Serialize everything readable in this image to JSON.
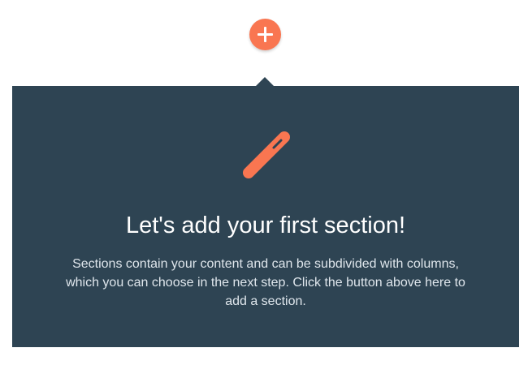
{
  "add_section": {
    "icon": "plus-icon",
    "color": "#f97651"
  },
  "empty_state": {
    "icon": "pencil-icon",
    "background": "#2e4453",
    "accent": "#f97651",
    "title": "Let's add your first section!",
    "description": "Sections contain your content and can be subdivided with columns, which you can choose in the next step. Click the button above here to add a section."
  }
}
